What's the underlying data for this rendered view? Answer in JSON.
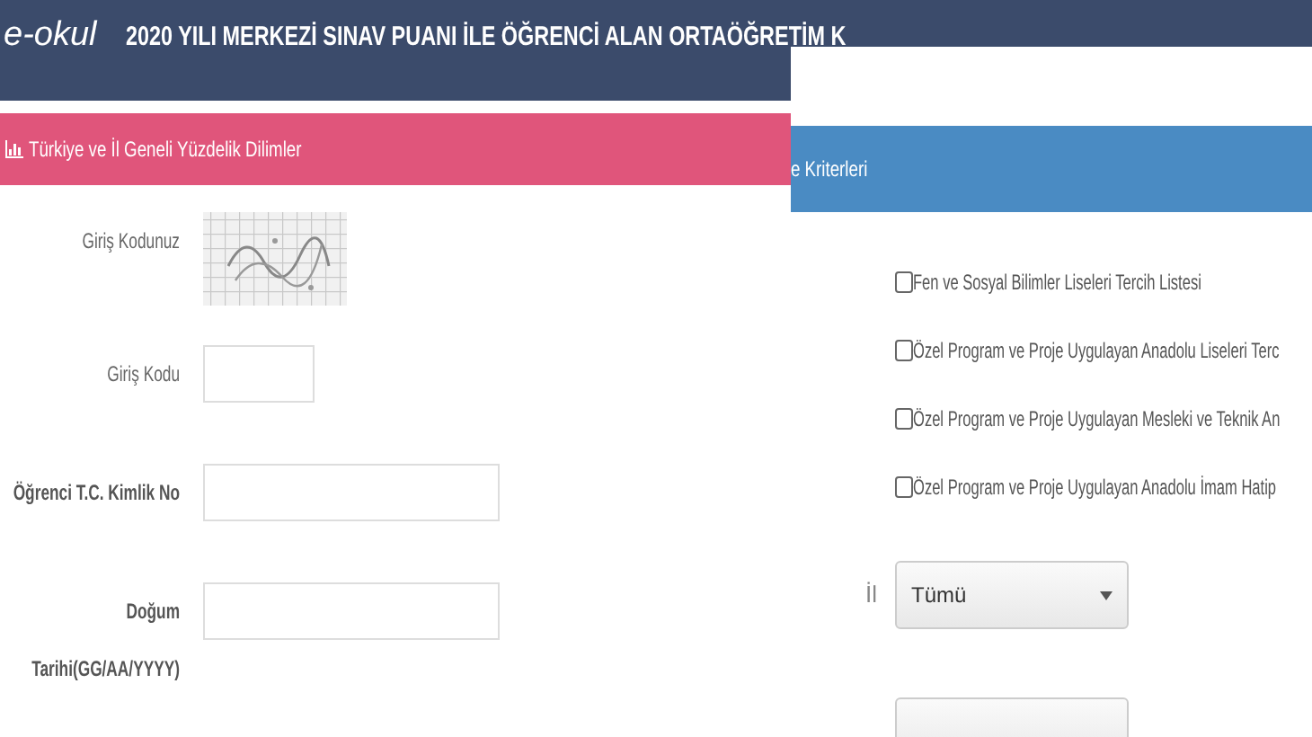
{
  "header": {
    "logo": "e-okul",
    "title": "2020 YILI MERKEZİ SINAV PUANI İLE ÖĞRENCİ ALAN ORTAÖĞRETİM K"
  },
  "left_panel": {
    "heading": "Türkiye ve İl Geneli Yüzdelik Dilimler",
    "fields": [
      {
        "kind": "captcha",
        "label": "Giriş Kodunuz"
      },
      {
        "kind": "short",
        "label": "Giriş Kodu"
      },
      {
        "kind": "long",
        "label": "Öğrenci T.C. Kimlik No"
      },
      {
        "kind": "long",
        "label": "Doğum Tarihi(GG/AA/YYYY)"
      }
    ]
  },
  "right_panel": {
    "heading": "e Kriterleri",
    "checkboxes": [
      {
        "label": "Fen ve Sosyal Bilimler Liseleri Tercih Listesi",
        "checked": false
      },
      {
        "label": "Özel Program ve Proje Uygulayan Anadolu Liseleri Terc",
        "checked": false
      },
      {
        "label": "Özel Program ve Proje Uygulayan Mesleki ve Teknik An",
        "checked": false
      },
      {
        "label": "Özel Program ve Proje Uygulayan Anadolu İmam Hatip",
        "checked": false
      }
    ],
    "selects": [
      {
        "kind": "full",
        "label": "İl",
        "value": "Tümü"
      },
      {
        "kind": "cut"
      }
    ]
  }
}
